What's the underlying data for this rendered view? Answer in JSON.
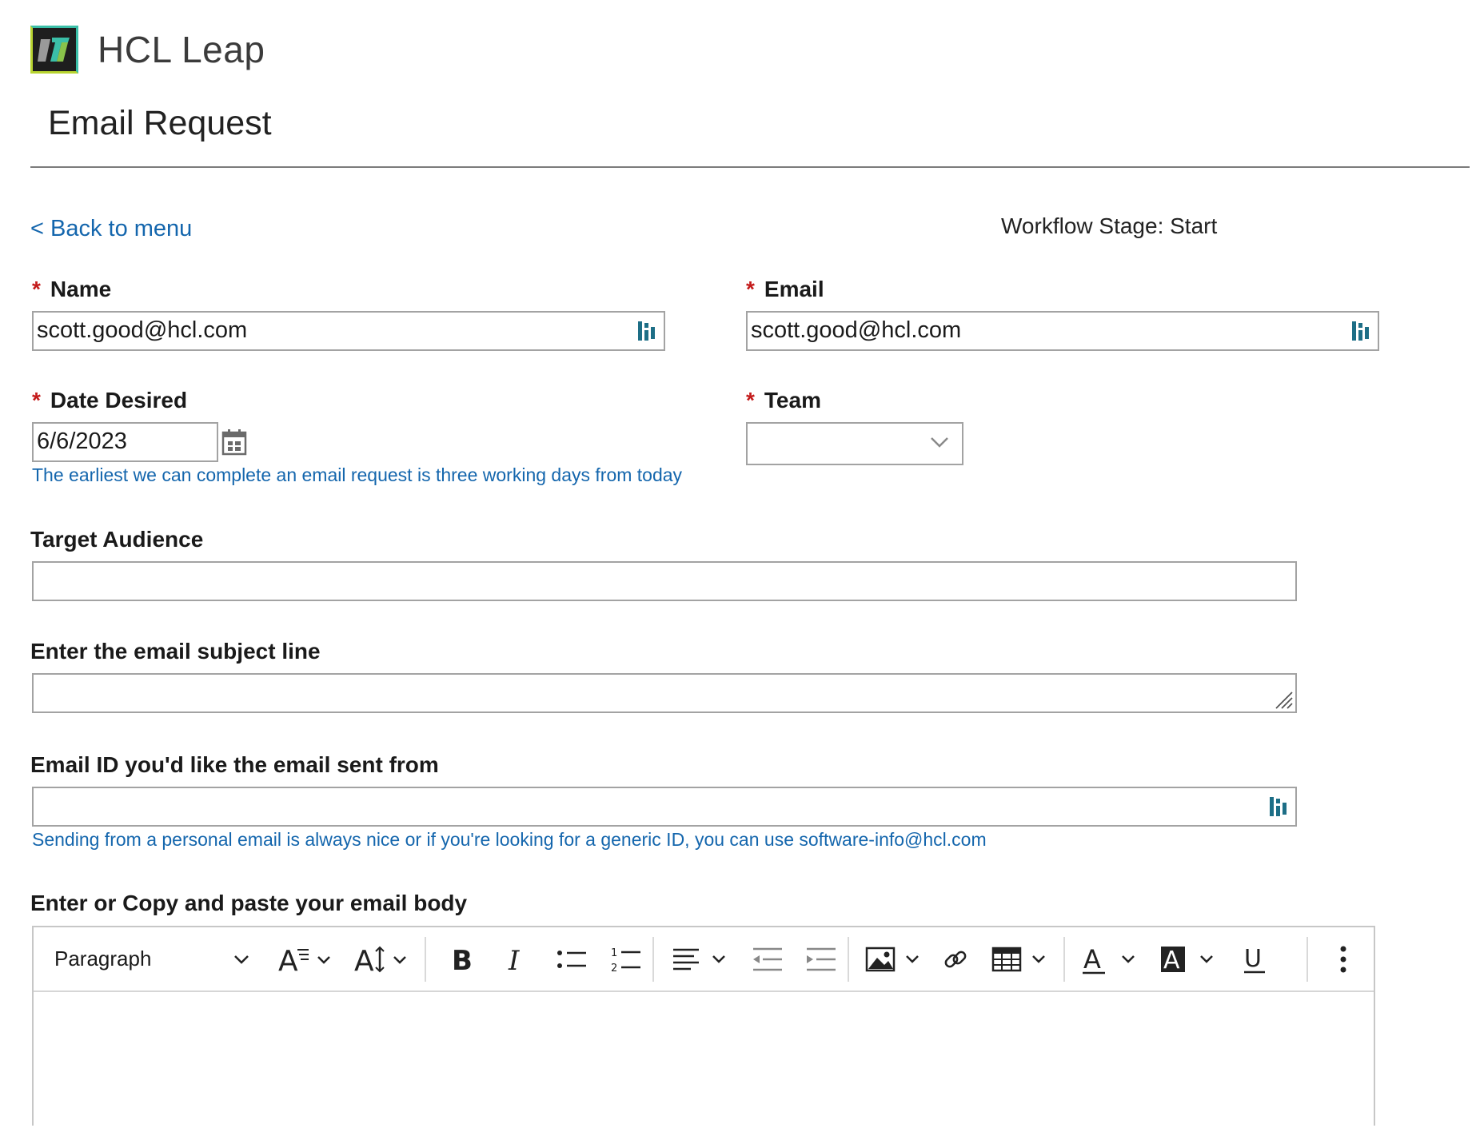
{
  "header": {
    "logo_icon": "hcl-leap-logo-icon",
    "app_name": "HCL Leap",
    "page_title": "Email Request"
  },
  "nav": {
    "back_link": "< Back to menu",
    "workflow_stage": "Workflow Stage: Start"
  },
  "form": {
    "name": {
      "label": "Name",
      "required": "*",
      "value": "scott.good@hcl.com",
      "icon": "lookup-icon"
    },
    "email": {
      "label": "Email",
      "required": "*",
      "value": "scott.good@hcl.com",
      "icon": "lookup-icon"
    },
    "date_desired": {
      "label": "Date Desired",
      "required": "*",
      "value": "6/6/2023",
      "icon": "calendar-icon",
      "help": "The earliest we can complete an email request is three working days from today"
    },
    "team": {
      "label": "Team",
      "required": "*",
      "value": "",
      "icon": "chevron-down-icon"
    },
    "target_audience": {
      "label": "Target Audience",
      "value": ""
    },
    "subject_line": {
      "label": "Enter the email subject line",
      "value": ""
    },
    "sender_id": {
      "label": "Email ID you'd like the email sent from",
      "value": "",
      "icon": "lookup-icon",
      "help": "Sending from a personal email is always nice or if you're looking for a generic ID, you can use software-info@hcl.com"
    },
    "email_body": {
      "label": "Enter or Copy and paste your email body",
      "toolbar": {
        "paragraph_format": "Paragraph",
        "buttons": [
          "heading-chevron-down-icon",
          "font-family-icon",
          "font-size-icon",
          "bold-icon",
          "italic-icon",
          "bulleted-list-icon",
          "numbered-list-icon",
          "align-left-icon",
          "outdent-icon",
          "indent-icon",
          "insert-image-icon",
          "link-icon",
          "insert-table-icon",
          "font-color-icon",
          "background-color-icon",
          "underline-icon",
          "more-options-icon"
        ]
      }
    }
  },
  "colors": {
    "link_blue": "#1466ad",
    "required_red": "#c41b1b",
    "lookup_teal": "#1d6e86",
    "border_gray": "#a3a3a3"
  }
}
